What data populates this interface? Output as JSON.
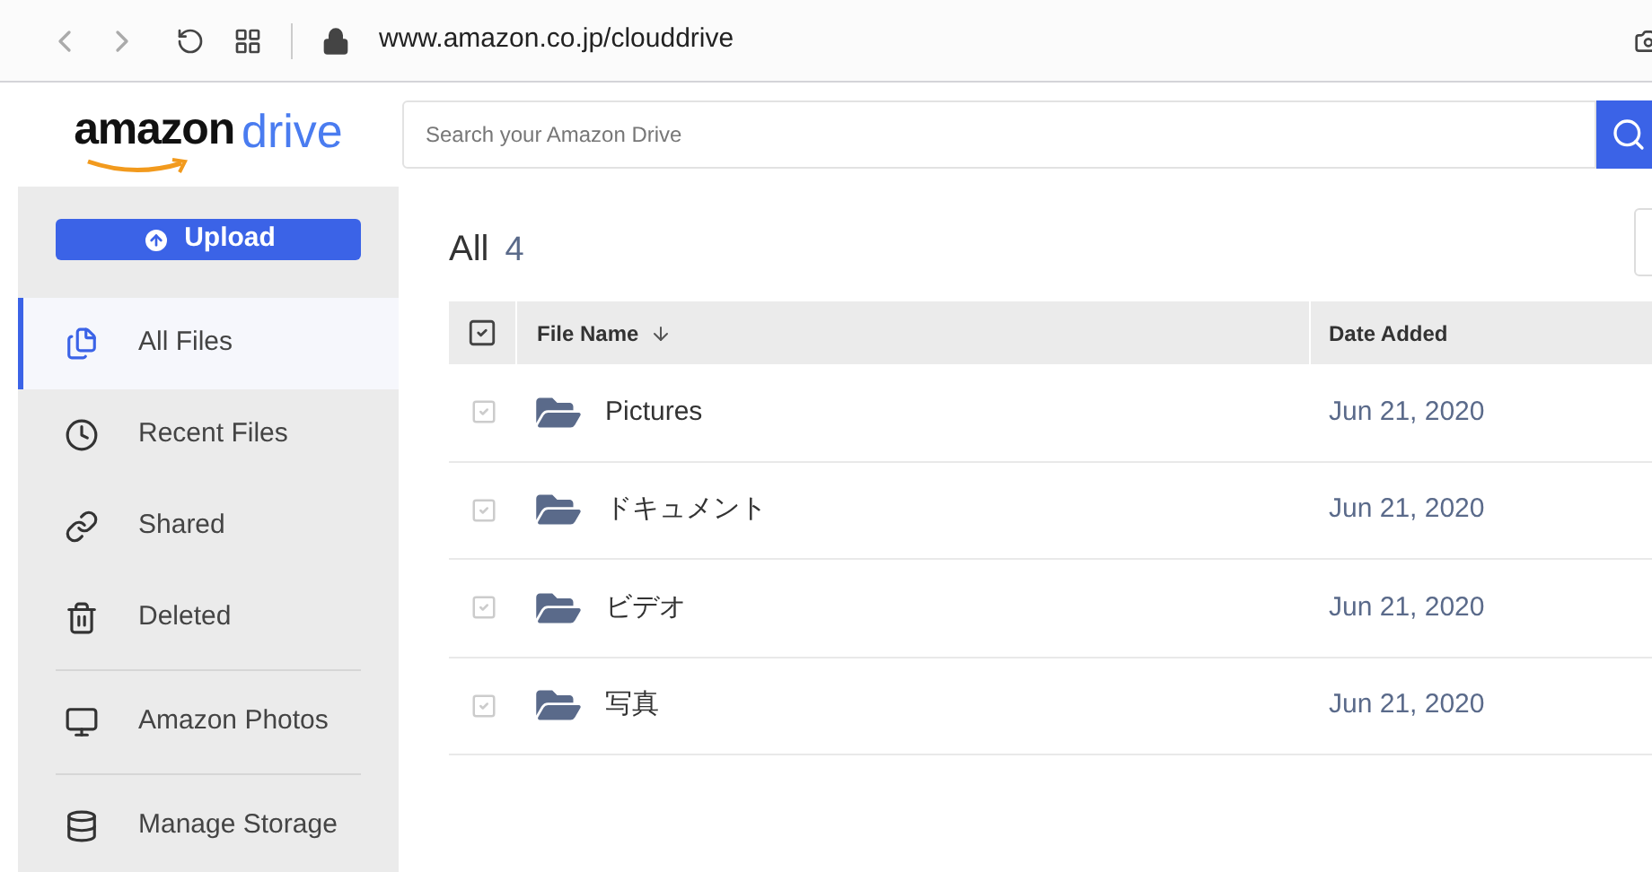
{
  "browser": {
    "url": "www.amazon.co.jp/clouddrive"
  },
  "header": {
    "logo": {
      "brand": "amazon",
      "product": "drive"
    },
    "search": {
      "placeholder": "Search your Amazon Drive"
    }
  },
  "sidebar": {
    "upload_button": "Upload",
    "items": [
      {
        "kind": "files",
        "label": "All Files",
        "selected": true
      },
      {
        "kind": "recent",
        "label": "Recent Files",
        "selected": false
      },
      {
        "kind": "shared",
        "label": "Shared",
        "selected": false
      },
      {
        "kind": "deleted",
        "label": "Deleted",
        "selected": false
      },
      {
        "kind": "photos",
        "label": "Amazon Photos",
        "selected": false
      },
      {
        "kind": "storage",
        "label": "Manage Storage",
        "selected": false
      }
    ]
  },
  "main": {
    "title": "All",
    "count": "4",
    "table": {
      "select_all": {
        "checked": false
      },
      "columns": [
        "File Name",
        "Date Added"
      ],
      "rows": [
        {
          "name": "Pictures",
          "date": "Jun 21, 2020",
          "checked": false
        },
        {
          "name": "ドキュメント",
          "date": "Jun 21, 2020",
          "checked": false
        },
        {
          "name": "ビデオ",
          "date": "Jun 21, 2020",
          "checked": false
        },
        {
          "name": "写真",
          "date": "Jun 21, 2020",
          "checked": false
        }
      ]
    }
  }
}
